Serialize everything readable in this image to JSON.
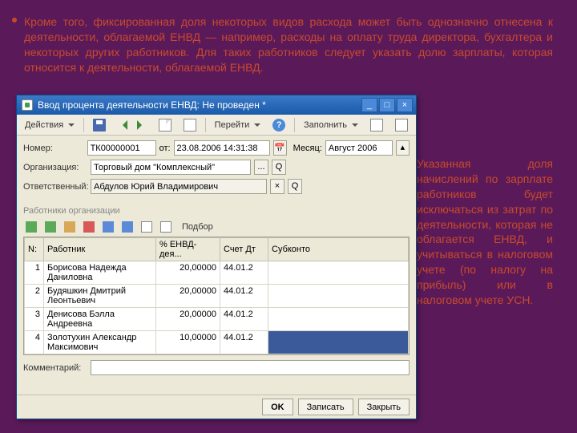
{
  "background": {
    "top_text": "Кроме того, фиксированная доля некоторых видов расхода может быть однозначно отнесена к деятельности, облагаемой ЕНВД — например, расходы на оплату труда директора, бухгалтера и некоторых других работников. Для таких работников следует указать долю зарплаты, которая относится к деятельности, облагаемой ЕНВД.",
    "right_text": "Указанная доля начислений по зарплате работников будет исключаться из затрат по деятельности, которая не облагается ЕНВД, и учитываться в налоговом учете (по налогу на прибыль) или в налоговом учете УСН."
  },
  "window": {
    "title": "Ввод процента деятельности ЕНВД: Не проведен *",
    "toolbar": {
      "actions": "Действия",
      "go": "Перейти",
      "fill": "Заполнить"
    },
    "form": {
      "number_label": "Номер:",
      "number_value": "ТК00000001",
      "from_label": "от:",
      "from_value": "23.08.2006 14:31:38",
      "month_label": "Месяц:",
      "month_value": "Август 2006",
      "org_label": "Организация:",
      "org_value": "Торговый дом \"Комплексный\"",
      "resp_label": "Ответственный:",
      "resp_value": "Абдулов Юрий Владимирович",
      "comment_label": "Комментарий:",
      "comment_value": ""
    },
    "section_label": "Работники организации",
    "subtoolbar": {
      "selection": "Подбор"
    },
    "grid": {
      "columns": [
        "N:",
        "Работник",
        "% ЕНВД-дея...",
        "Счет Дт",
        "Субконто"
      ],
      "rows": [
        {
          "n": "1",
          "name": "Борисова Надежда Даниловна",
          "pct": "20,00000",
          "acct": "44.01.2",
          "sub": ""
        },
        {
          "n": "2",
          "name": "Будяшкин Дмитрий Леонтьевич",
          "pct": "20,00000",
          "acct": "44.01.2",
          "sub": ""
        },
        {
          "n": "3",
          "name": "Денисова Бэлла Андреевна",
          "pct": "20,00000",
          "acct": "44.01.2",
          "sub": ""
        },
        {
          "n": "4",
          "name": "Золотухин Александр Максимович",
          "pct": "10,00000",
          "acct": "44.01.2",
          "sub": ""
        }
      ]
    },
    "buttons": {
      "ok": "OK",
      "save": "Записать",
      "close": "Закрыть"
    }
  }
}
